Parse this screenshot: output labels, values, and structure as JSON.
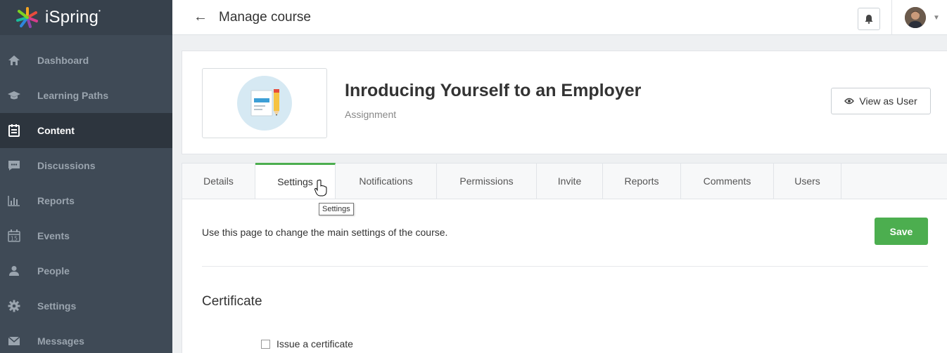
{
  "app": {
    "logo_text": "iSpring"
  },
  "sidebar": {
    "items": [
      {
        "label": "Dashboard",
        "icon": "home-icon",
        "active": false
      },
      {
        "label": "Learning Paths",
        "icon": "graduation-cap-icon",
        "active": false
      },
      {
        "label": "Content",
        "icon": "document-list-icon",
        "active": true
      },
      {
        "label": "Discussions",
        "icon": "chat-bubble-icon",
        "active": false
      },
      {
        "label": "Reports",
        "icon": "bar-chart-icon",
        "active": false
      },
      {
        "label": "Events",
        "icon": "calendar-icon",
        "active": false
      },
      {
        "label": "People",
        "icon": "person-icon",
        "active": false
      },
      {
        "label": "Settings",
        "icon": "gear-icon",
        "active": false
      },
      {
        "label": "Messages",
        "icon": "envelope-icon",
        "active": false
      }
    ]
  },
  "topbar": {
    "title": "Manage course"
  },
  "course": {
    "title": "Inroducing Yourself to an Employer",
    "type": "Assignment",
    "view_as_user_label": "View as User"
  },
  "tabs": [
    {
      "label": "Details",
      "active": false
    },
    {
      "label": "Settings",
      "active": true
    },
    {
      "label": "Notifications",
      "active": false
    },
    {
      "label": "Permissions",
      "active": false
    },
    {
      "label": "Invite",
      "active": false
    },
    {
      "label": "Reports",
      "active": false
    },
    {
      "label": "Comments",
      "active": false
    },
    {
      "label": "Users",
      "active": false
    }
  ],
  "tooltip": "Settings",
  "settings": {
    "description": "Use this page to change the main settings of the course.",
    "save_label": "Save",
    "certificate_heading": "Certificate",
    "issue_certificate_label": "Issue a certificate",
    "issue_certificate_checked": false
  },
  "colors": {
    "sidebar_bg": "#3f4a56",
    "sidebar_active_bg": "#2d353e",
    "accent_green": "#4cae4f"
  }
}
